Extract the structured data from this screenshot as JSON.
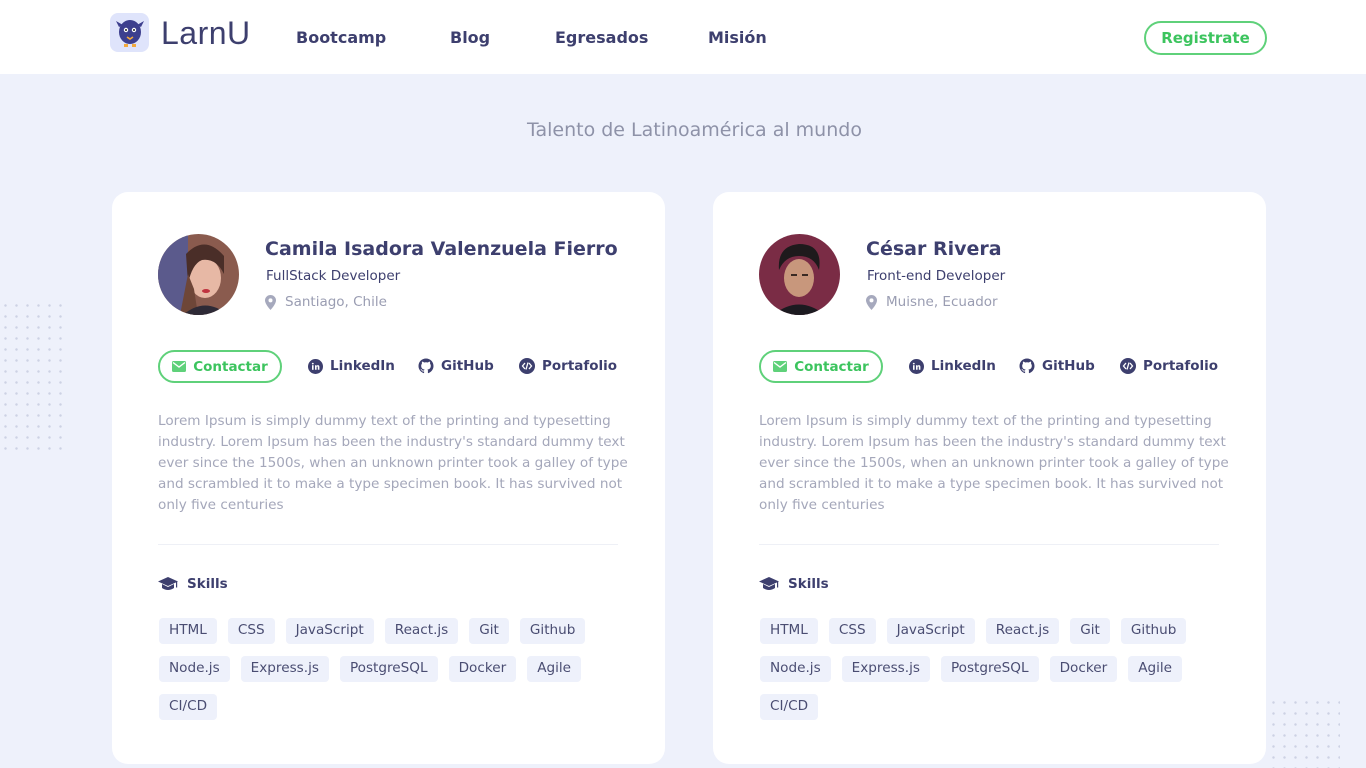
{
  "header": {
    "logo_text": "LarnU",
    "nav": [
      "Bootcamp",
      "Blog",
      "Egresados",
      "Misión"
    ],
    "register_label": "Registrate"
  },
  "page_title": "Talento de Latinoamérica al mundo",
  "colors": {
    "accent_green": "#5fd17a",
    "text_dark": "#3d3f6e",
    "background": "#eef1fb"
  },
  "profiles": [
    {
      "name": "Camila Isadora Valenzuela Fierro",
      "role": "FullStack Developer",
      "location": "Santiago, Chile",
      "contact_label": "Contactar",
      "links": [
        "LinkedIn",
        "GitHub",
        "Portafolio"
      ],
      "bio": "Lorem Ipsum is simply dummy text of the printing and typesetting industry. Lorem Ipsum has been the industry's standard dummy text ever since the 1500s, when an unknown printer took a galley of type and scrambled it to make a type specimen book. It has survived not only five centuries",
      "skills_label": "Skills",
      "skills": [
        "HTML",
        "CSS",
        "JavaScript",
        "React.js",
        "Git",
        "Github",
        "Node.js",
        "Express.js",
        "PostgreSQL",
        "Docker",
        "Agile",
        "CI/CD"
      ]
    },
    {
      "name": "César Rivera",
      "role": "Front-end Developer",
      "location": "Muisne, Ecuador",
      "contact_label": "Contactar",
      "links": [
        "LinkedIn",
        "GitHub",
        "Portafolio"
      ],
      "bio": "Lorem Ipsum is simply dummy text of the printing and typesetting industry. Lorem Ipsum has been the industry's standard dummy text ever since the 1500s, when an unknown printer took a galley of type and scrambled it to make a type specimen book. It has survived not only five centuries",
      "skills_label": "Skills",
      "skills": [
        "HTML",
        "CSS",
        "JavaScript",
        "React.js",
        "Git",
        "Github",
        "Node.js",
        "Express.js",
        "PostgreSQL",
        "Docker",
        "Agile",
        "CI/CD"
      ]
    }
  ]
}
